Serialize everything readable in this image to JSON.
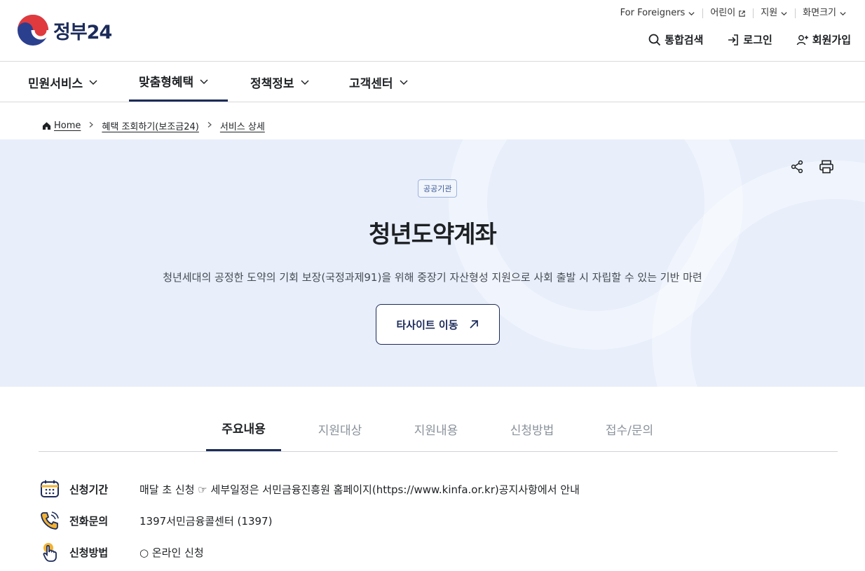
{
  "header": {
    "logo_text": "정부24",
    "util": [
      "For Foreigners",
      "어린이",
      "지원",
      "화면크기"
    ],
    "actions": {
      "search": "통합검색",
      "login": "로그인",
      "signup": "회원가입"
    }
  },
  "gnb": [
    "민원서비스",
    "맞춤형혜택",
    "정책정보",
    "고객센터"
  ],
  "breadcrumb": {
    "home": "Home",
    "level1": "혜택 조회하기(보조금24)",
    "level2": "서비스 상세"
  },
  "hero": {
    "badge": "공공기관",
    "title": "청년도약계좌",
    "description": "청년세대의 공정한 도약의 기회 보장(국정과제91)을 위해 중장기 자산형성 지원으로 사회 출발 시 자립할 수 있는 기반 마련",
    "button": "타사이트 이동"
  },
  "tabs": [
    "주요내용",
    "지원대상",
    "지원내용",
    "신청방법",
    "접수/문의"
  ],
  "info": [
    {
      "label": "신청기간",
      "value": "매달 초 신청 ☞ 세부일정은 서민금융진흥원 홈페이지(https://www.kinfa.or.kr)공지사항에서 안내"
    },
    {
      "label": "전화문의",
      "value": "1397서민금융콜센터 (1397)"
    },
    {
      "label": "신청방법",
      "value": "○ 온라인 신청"
    }
  ],
  "colors": {
    "brand_navy": "#1c2b5a",
    "hero_bg": "#e8eefa",
    "logo_red": "#e65c3b",
    "logo_blue": "#2b3f8f"
  }
}
